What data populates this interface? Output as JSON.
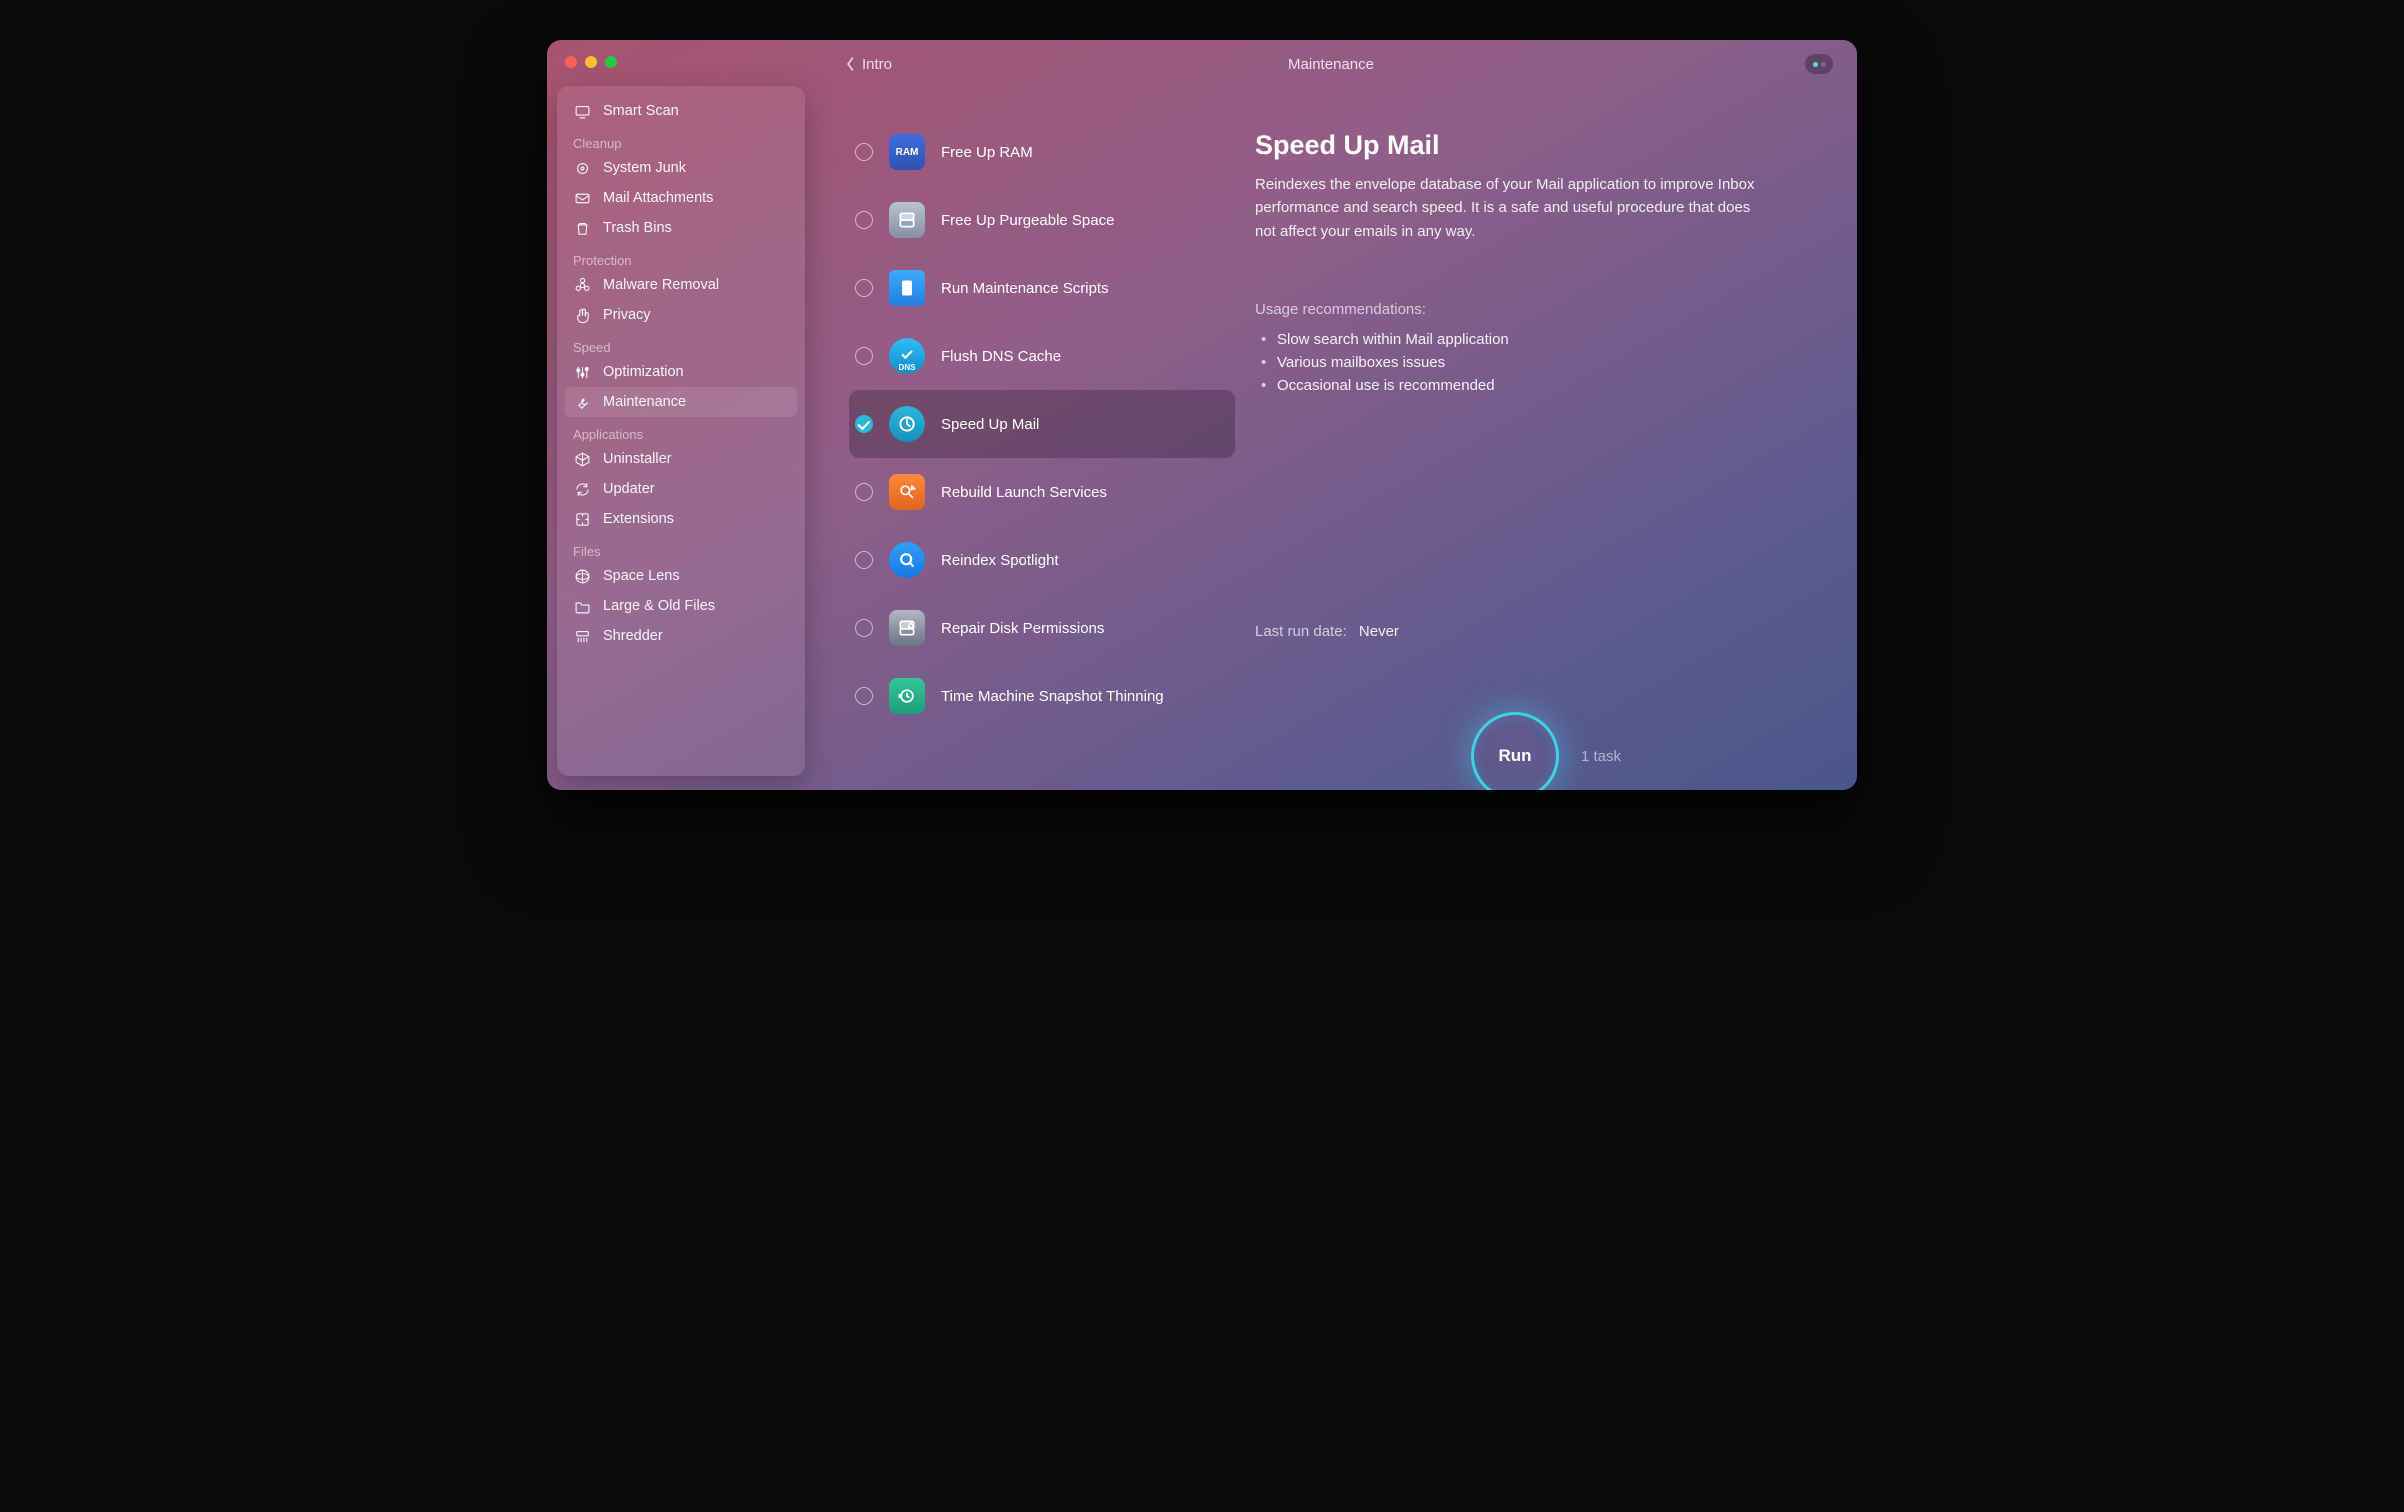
{
  "header": {
    "back_label": "Intro",
    "crumb": "Maintenance"
  },
  "sidebar": {
    "top": {
      "label": "Smart Scan"
    },
    "sections": [
      {
        "title": "Cleanup",
        "items": [
          {
            "label": "System Junk",
            "icon": "chip-icon"
          },
          {
            "label": "Mail Attachments",
            "icon": "envelope-icon"
          },
          {
            "label": "Trash Bins",
            "icon": "trash-icon"
          }
        ]
      },
      {
        "title": "Protection",
        "items": [
          {
            "label": "Malware Removal",
            "icon": "biohazard-icon"
          },
          {
            "label": "Privacy",
            "icon": "hand-icon"
          }
        ]
      },
      {
        "title": "Speed",
        "items": [
          {
            "label": "Optimization",
            "icon": "sliders-icon"
          },
          {
            "label": "Maintenance",
            "icon": "wrench-icon",
            "active": true
          }
        ]
      },
      {
        "title": "Applications",
        "items": [
          {
            "label": "Uninstaller",
            "icon": "box-icon"
          },
          {
            "label": "Updater",
            "icon": "refresh-icon"
          },
          {
            "label": "Extensions",
            "icon": "puzzle-icon"
          }
        ]
      },
      {
        "title": "Files",
        "items": [
          {
            "label": "Space Lens",
            "icon": "lens-icon"
          },
          {
            "label": "Large & Old Files",
            "icon": "folder-icon"
          },
          {
            "label": "Shredder",
            "icon": "shredder-icon"
          }
        ]
      }
    ]
  },
  "tasks": [
    {
      "label": "Free Up RAM",
      "checked": false,
      "icon_class": "ti-ram",
      "icon_text": "RAM"
    },
    {
      "label": "Free Up Purgeable Space",
      "checked": false,
      "icon_class": "ti-purge"
    },
    {
      "label": "Run Maintenance Scripts",
      "checked": false,
      "icon_class": "ti-scripts"
    },
    {
      "label": "Flush DNS Cache",
      "checked": false,
      "icon_class": "ti-dns",
      "icon_text": "DNS"
    },
    {
      "label": "Speed Up Mail",
      "checked": true,
      "selected": true,
      "icon_class": "ti-mail"
    },
    {
      "label": "Rebuild Launch Services",
      "checked": false,
      "icon_class": "ti-launch"
    },
    {
      "label": "Reindex Spotlight",
      "checked": false,
      "icon_class": "ti-spot"
    },
    {
      "label": "Repair Disk Permissions",
      "checked": false,
      "icon_class": "ti-disk"
    },
    {
      "label": "Time Machine Snapshot Thinning",
      "checked": false,
      "icon_class": "ti-tm"
    }
  ],
  "detail": {
    "title": "Speed Up Mail",
    "description": "Reindexes the envelope database of your Mail application to improve Inbox performance and search speed. It is a safe and useful procedure that does not affect your emails in any way.",
    "usage_heading": "Usage recommendations:",
    "usage": [
      "Slow search within Mail application",
      "Various mailboxes issues",
      "Occasional use is recommended"
    ],
    "last_run_label": "Last run date:",
    "last_run_value": "Never",
    "run_label": "Run",
    "task_count": "1 task"
  }
}
